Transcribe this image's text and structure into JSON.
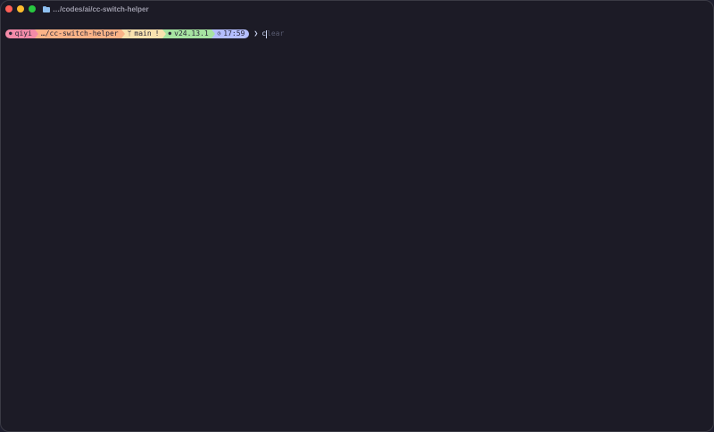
{
  "window": {
    "title": "…/codes/ai/cc-switch-helper",
    "title_icon": "folder-icon"
  },
  "prompt": {
    "user_icon": "apple-icon",
    "user": "qiyi",
    "path": "…/cc-switch-helper",
    "git_icon": "git-branch-icon",
    "git_branch": "main",
    "git_status": "!",
    "node_icon": "node-icon",
    "node_version": "v24.13.1",
    "time_icon": "clock-icon",
    "time": "17:59",
    "caret": "❯",
    "typed": "c",
    "autosuggestion": "lear"
  },
  "colors": {
    "background": "#1c1b26",
    "user_segment": "#f38ba8",
    "path_segment": "#fab387",
    "git_segment": "#f9e2af",
    "node_segment": "#a6e3a1",
    "time_segment": "#b4befe"
  }
}
